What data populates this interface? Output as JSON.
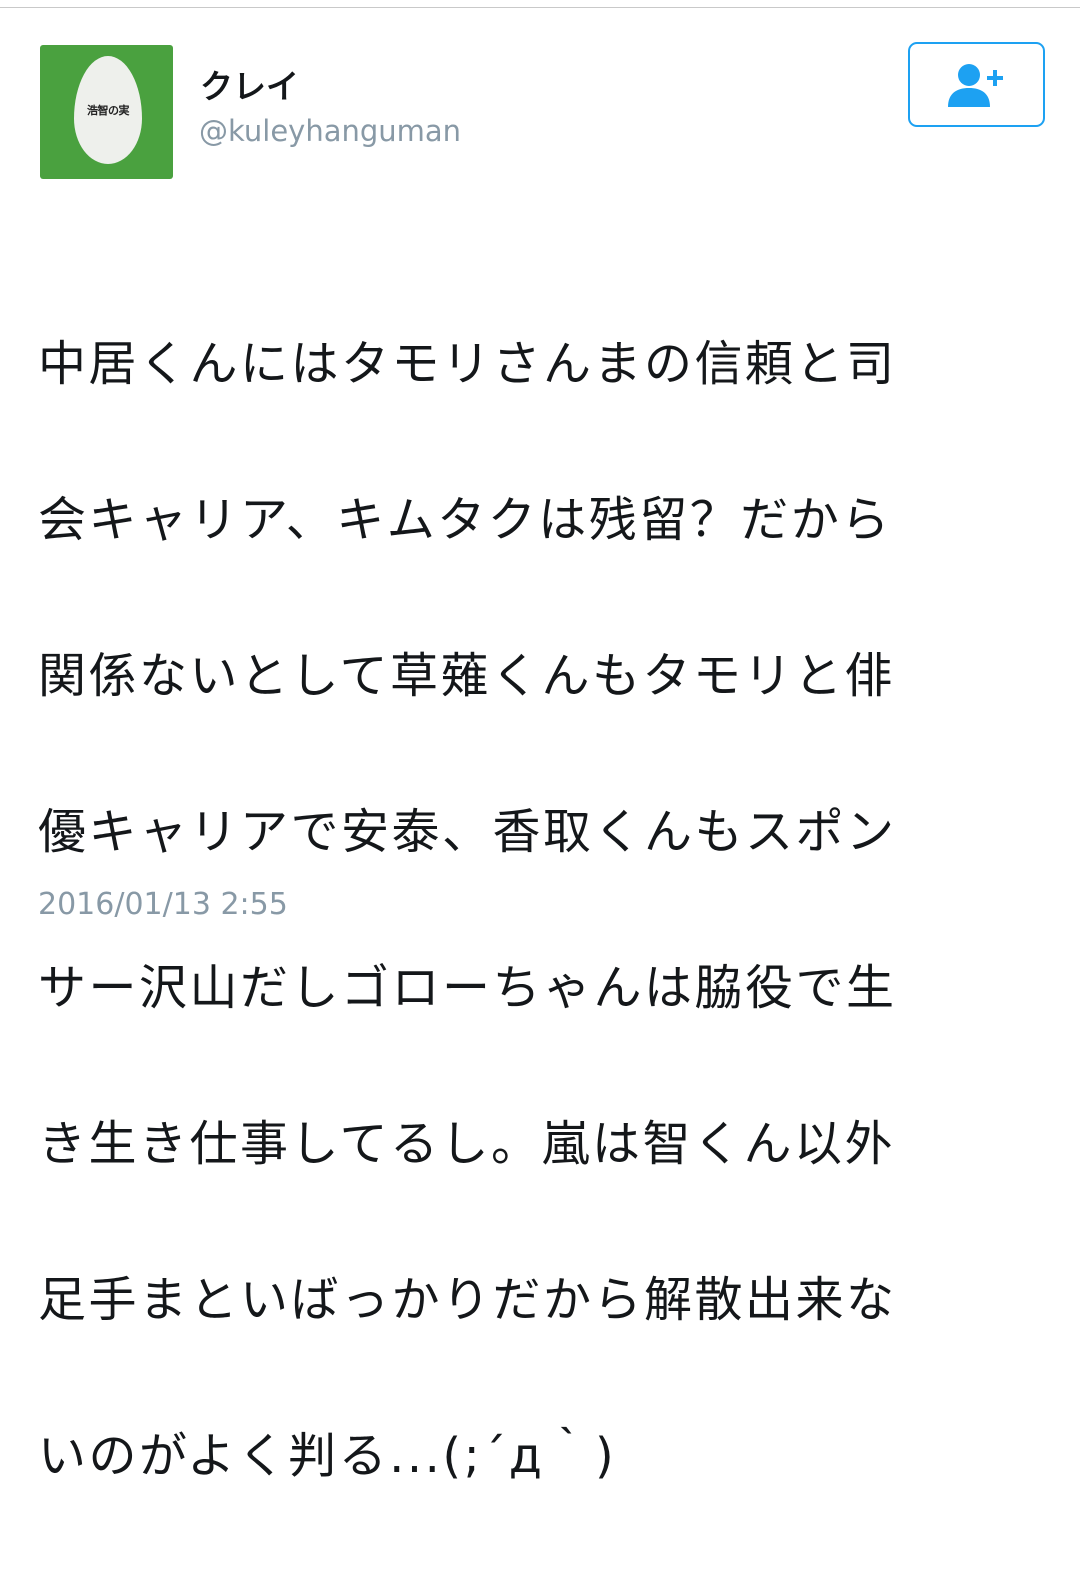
{
  "tweet": {
    "author": {
      "display_name": "クレイ",
      "handle": "@kuleyhanguman",
      "avatar": {
        "text": "浩智の実",
        "background_color": "#4aa13f",
        "egg_color": "#eef0ec"
      }
    },
    "follow_button": {
      "icon": "add-user-icon",
      "color": "#1da1f2"
    },
    "text_lines": [
      "中居くんにはタモリさんまの信頼と司",
      "会キャリア、キムタクは残留？だから",
      "関係ないとして草薙くんもタモリと俳",
      "優キャリアで安泰、香取くんもスポン",
      "サー沢山だしゴローちゃんは脇役で生",
      "き生き仕事してるし。嵐は智くん以外",
      "足手まといばっかりだから解散出来な",
      "いのがよく判る...(;´д｀)"
    ],
    "timestamp": "2016/01/13 2:55"
  }
}
